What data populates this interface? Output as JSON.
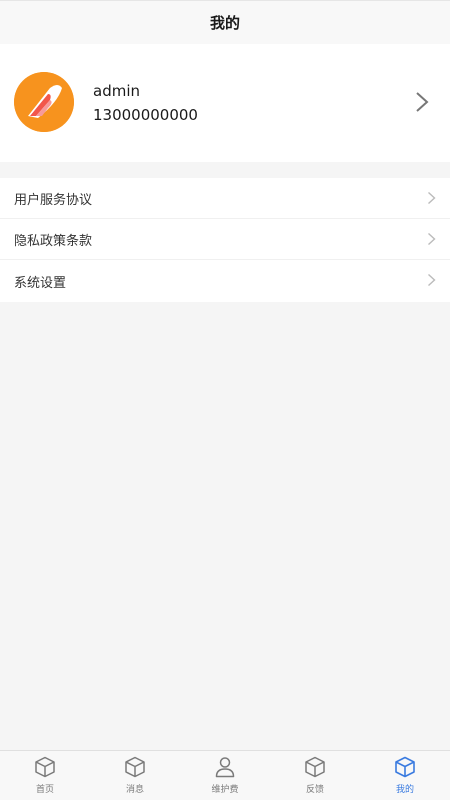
{
  "header": {
    "title": "我的"
  },
  "profile": {
    "name": "admin",
    "phone": "13000000000"
  },
  "menu": {
    "items": [
      {
        "label": "用户服务协议"
      },
      {
        "label": "隐私政策条款"
      },
      {
        "label": "系统设置"
      }
    ]
  },
  "tabbar": {
    "active_color": "#3a7be0",
    "inactive_color": "#7a7a7a",
    "items": [
      {
        "label": "首页",
        "icon": "cube-icon"
      },
      {
        "label": "消息",
        "icon": "cube-icon"
      },
      {
        "label": "维护费",
        "icon": "person-icon"
      },
      {
        "label": "反馈",
        "icon": "cube-icon"
      },
      {
        "label": "我的",
        "icon": "cube-icon",
        "active": true
      }
    ]
  }
}
